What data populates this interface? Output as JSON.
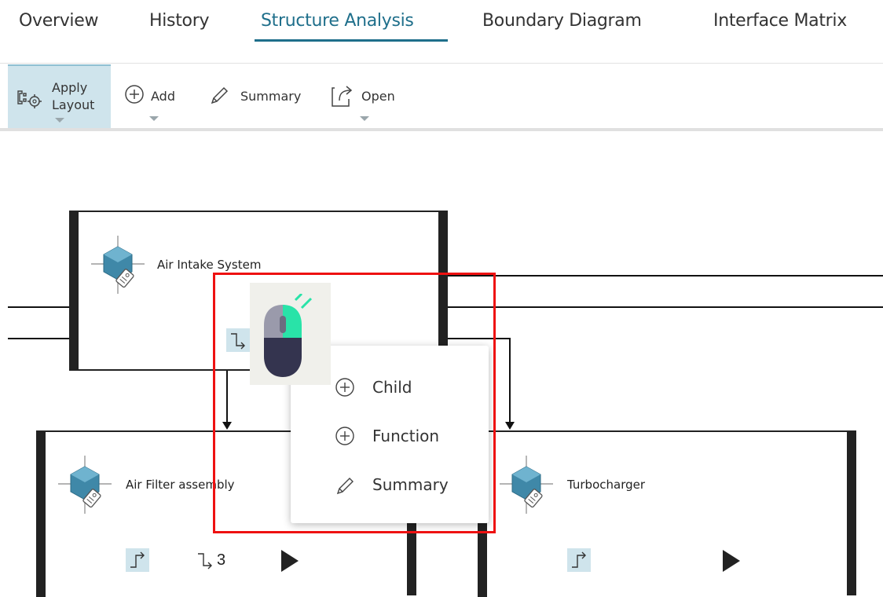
{
  "tabs": [
    {
      "label": "Overview",
      "active": false
    },
    {
      "label": "History",
      "active": false
    },
    {
      "label": "Structure Analysis",
      "active": true
    },
    {
      "label": "Boundary Diagram",
      "active": false
    },
    {
      "label": "Interface Matrix",
      "active": false
    }
  ],
  "toolbar": {
    "apply_layout_line1": "Apply",
    "apply_layout_line2": "Layout",
    "add_label": "Add",
    "summary_label": "Summary",
    "open_label": "Open"
  },
  "nodes": {
    "air_intake": {
      "title": "Air Intake System"
    },
    "air_filter": {
      "title": "Air Filter assembly",
      "child_count": "3"
    },
    "turbocharger": {
      "title": "Turbocharger"
    }
  },
  "context_menu": {
    "items": [
      {
        "label": "Child",
        "icon": "plus-circle-icon"
      },
      {
        "label": "Function",
        "icon": "plus-circle-icon"
      },
      {
        "label": "Summary",
        "icon": "pencil-icon"
      }
    ]
  },
  "colors": {
    "accent": "#1f6f8b",
    "selection_bg": "#cfe4ec",
    "highlight_border": "#e11111",
    "mouse_left_button": "#29e3a8",
    "mouse_body": "#34344f"
  }
}
